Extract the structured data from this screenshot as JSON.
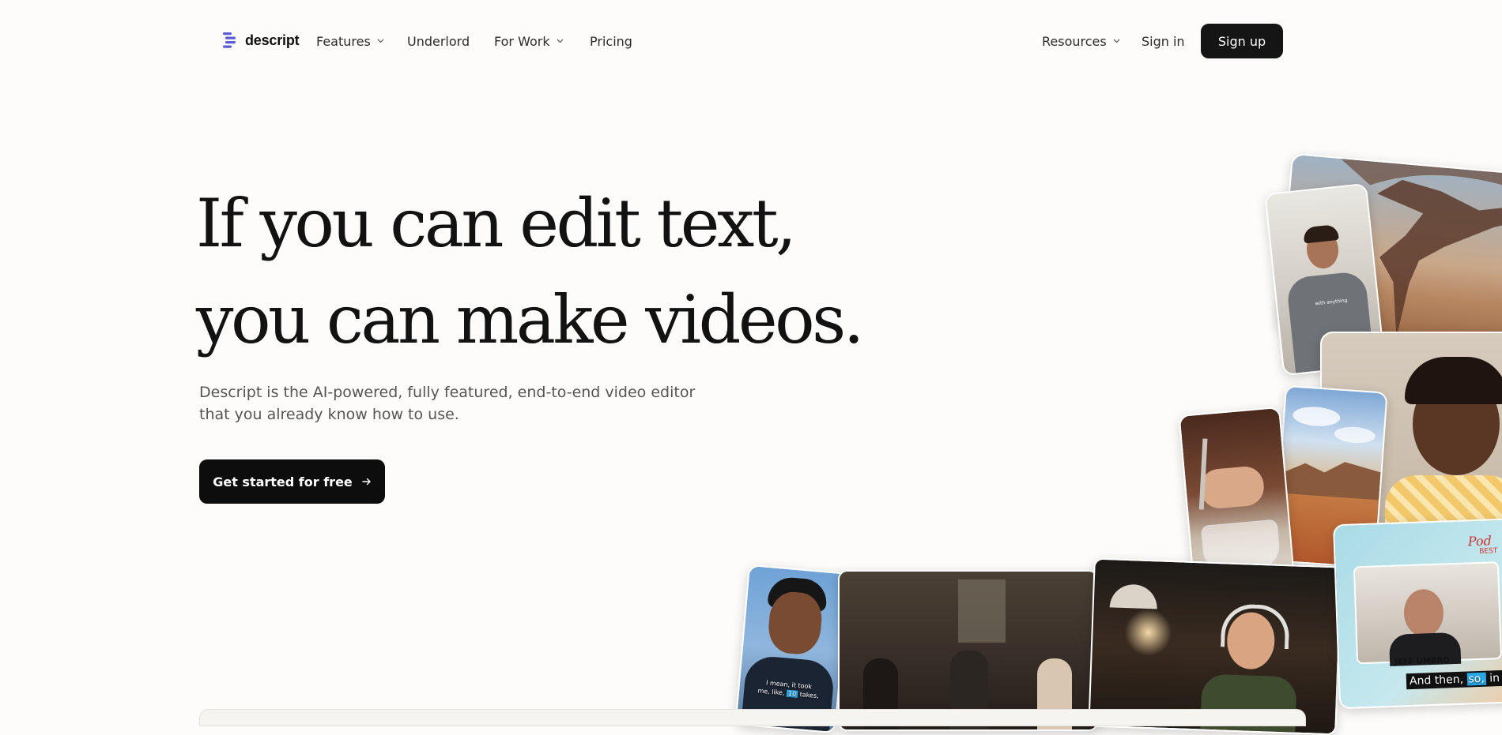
{
  "brand": {
    "name": "descript",
    "icon": "descript-logo-icon"
  },
  "nav": {
    "left": [
      {
        "label": "Features",
        "has_dropdown": true
      },
      {
        "label": "Underlord",
        "has_dropdown": false
      },
      {
        "label": "For Work",
        "has_dropdown": true
      },
      {
        "label": "Pricing",
        "has_dropdown": false
      }
    ],
    "right": {
      "resources": {
        "label": "Resources",
        "has_dropdown": true
      },
      "sign_in": "Sign in",
      "sign_up": "Sign up"
    }
  },
  "hero": {
    "headline_line1": "If you can edit text,",
    "headline_line2": "you can make videos.",
    "subtitle_line1": "Descript is the AI-powered, fully featured, end-to-end video editor",
    "subtitle_line2": "that you already know how to use.",
    "cta_label": "Get started for free",
    "cta_icon": "arrow-right-icon"
  },
  "collage": {
    "captions": {
      "shirt_text": "with anything",
      "student_caption_line1": "I mean, it took",
      "student_caption_line2_a": "me, like,",
      "student_caption_highlight": "10",
      "student_caption_line2_b": "takes,",
      "show_brand": "Pod",
      "show_tag": "BEST",
      "guest_name": "JEFF UMBRO",
      "bottom_caption_a": "And then,",
      "bottom_caption_highlight": "so,",
      "bottom_caption_b": "in th"
    },
    "colors": {
      "caption_highlight": "#2aa7e8",
      "tile_border": "#ffffff"
    }
  },
  "colors": {
    "background": "#fdfcfb",
    "button_dark": "#151515",
    "text_muted": "#555555"
  }
}
